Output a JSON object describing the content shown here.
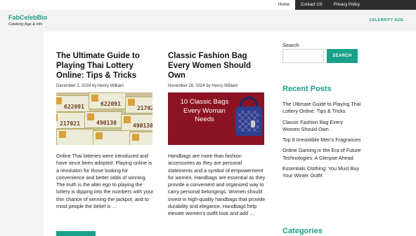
{
  "nav": {
    "items": [
      {
        "label": "Home",
        "active": true
      },
      {
        "label": "Contact US",
        "active": false
      },
      {
        "label": "Privacy Policy",
        "active": false
      }
    ]
  },
  "header": {
    "site_title": "FabCelebBio",
    "tagline": "Celebrity Age & Info",
    "category_link": "CELEBRITY AGE"
  },
  "posts": [
    {
      "title": "The Ultimate Guide to Playing Thai Lottery Online: Tips & Tricks",
      "meta": "December 2, 2024 by Henry William",
      "image": "thai-lottery-tickets",
      "excerpt": "Online Thai lotteries were introduced and have since been adopted. Playing online is a revolution for those looking for convenience and better odds of winning. The truth is the alter ego to playing the lottery is dipping into the numbers with your thin chance of winning the jackpot, and to most people the belief is …",
      "ticket_numbers": [
        "622091",
        "622091",
        "217021",
        "217021",
        "490138",
        "490138"
      ]
    },
    {
      "title": "Classic Fashion Bag Every Women Should Own",
      "meta": "November 28, 2024 by Henry William",
      "image": "fashion-bag-banner",
      "image_text": "10 Classic Bags Every Woman Needs",
      "excerpt": "Handbags are more than fashion accessories as they are personal statements and a symbol of empowerment for women. Handbags are essential as they provide a convenient and organized way to carry personal belongings. Women should invest in high-quality handbags that provide durability and elegance. Handbags help elevate women's outfit look and add …"
    }
  ],
  "sidebar": {
    "search_label": "Search",
    "search_value": "",
    "search_button": "SEARCH",
    "recent_heading": "Recent Posts",
    "recent_posts": [
      "The Ultimate Guide to Playing Thai Lottery Online: Tips & Tricks",
      "Classic Fashion Bag Every Women Should Own",
      "Top 8 Irresistible Men's Fragrances",
      "Online Gaming in the Era of Future Technologies: A Glimpse Ahead",
      "Essentials Clothing: You Must Buy Your Winter Outfit"
    ],
    "categories_heading": "Categories"
  },
  "colors": {
    "accent": "#1aa089",
    "nav_bg": "#2e2e2e",
    "page_bg": "#f3f3f3"
  }
}
